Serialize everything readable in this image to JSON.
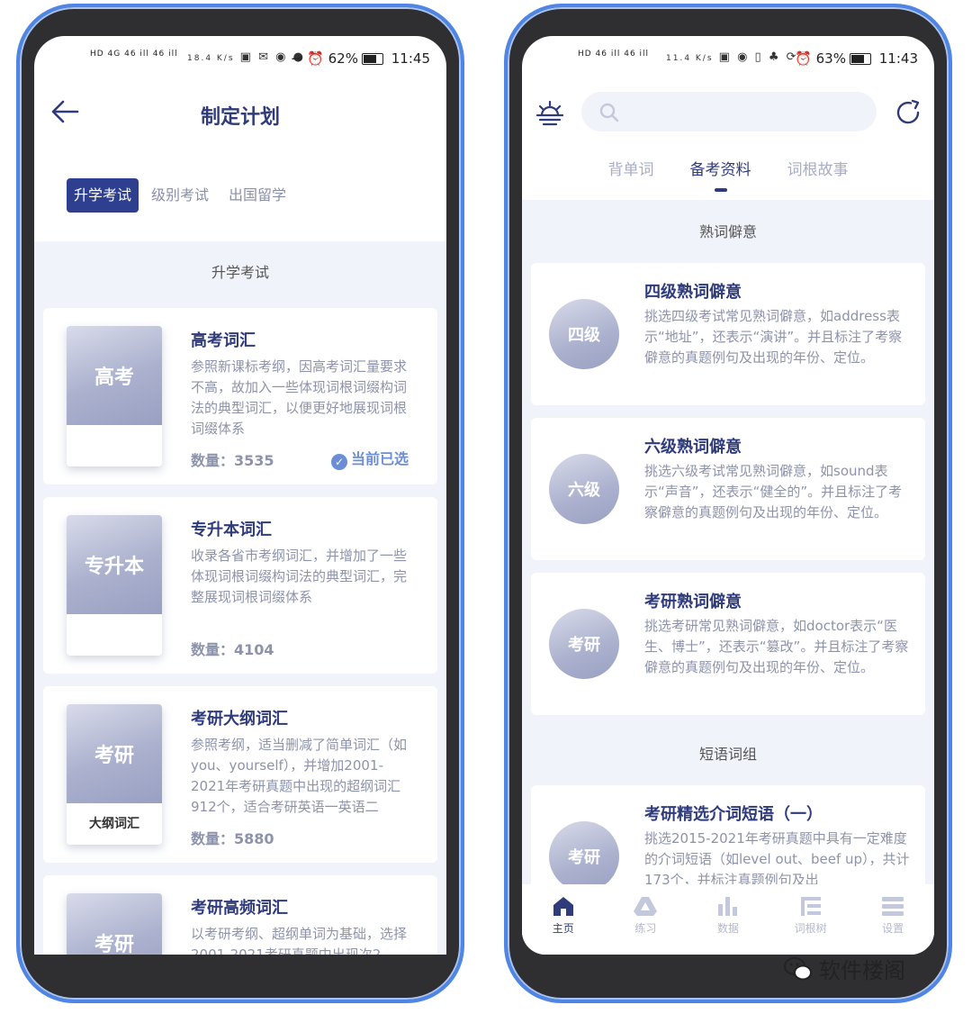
{
  "left": {
    "status": {
      "network": "HD 4G 46 ill 46 ill",
      "speed": "18.4 K/s",
      "battery": "62%",
      "time": "11:45"
    },
    "title": "制定计划",
    "tabs": [
      "升学考试",
      "级别考试",
      "出国留学"
    ],
    "section_title": "升学考试",
    "cards": [
      {
        "cover": "高考",
        "cover_sub": "",
        "title": "高考词汇",
        "desc": "参照新课标考纲，因高考词汇量要求不高，故加入一些体现词根词缀构词法的典型词汇，以便更好地展现词根词缀体系",
        "count": "数量：3535",
        "current": "当前已选"
      },
      {
        "cover": "专升本",
        "cover_sub": "",
        "title": "专升本词汇",
        "desc": "收录各省市考纲词汇，并增加了一些体现词根词缀构词法的典型词汇，完整展现词根词缀体系",
        "count": "数量：4104"
      },
      {
        "cover": "考研",
        "cover_sub": "大纲词汇",
        "title": "考研大纲词汇",
        "desc": "参照考纲，适当删减了简单词汇（如you、yourself），并增加2001-2021年考研真题中出现的超纲词汇912个，适合考研英语一英语二",
        "count": "数量：5880"
      },
      {
        "cover": "考研",
        "cover_sub": "",
        "title": "考研高频词汇",
        "desc": "以考研考纲、超纲单词为基础，选择2001-2021考研真题中出现次2",
        "count": ""
      }
    ]
  },
  "right": {
    "status": {
      "network": "HD 46 ill 46 ill",
      "speed": "11.4 K/s",
      "battery": "63%",
      "time": "11:43"
    },
    "tabs": [
      "背单词",
      "备考资料",
      "词根故事"
    ],
    "section1": "熟词僻意",
    "section2": "短语词组",
    "cards": [
      {
        "circle": "四级",
        "title": "四级熟词僻意",
        "desc": "挑选四级考试常见熟词僻意，如address表示“地址”，还表示“演讲”。并且标注了考察僻意的真题例句及出现的年份、定位。"
      },
      {
        "circle": "六级",
        "title": "六级熟词僻意",
        "desc": "挑选六级考试常见熟词僻意，如sound表示“声音”，还表示“健全的”。并且标注了考察僻意的真题例句及出现的年份、定位。"
      },
      {
        "circle": "考研",
        "title": "考研熟词僻意",
        "desc": "挑选考研常见熟词僻意，如doctor表示“医生、博士”，还表示“篡改”。并且标注了考察僻意的真题例句及出现的年份、定位。"
      },
      {
        "circle": "考研",
        "title": "考研精选介词短语（一）",
        "desc": "挑选2015-2021年考研真题中具有一定难度的介词短语（如level out、beef up），共计173个，并标注真题例句及出"
      }
    ],
    "nav": [
      "主页",
      "练习",
      "数据",
      "词根树",
      "设置"
    ]
  },
  "watermark": "软件楼阁"
}
